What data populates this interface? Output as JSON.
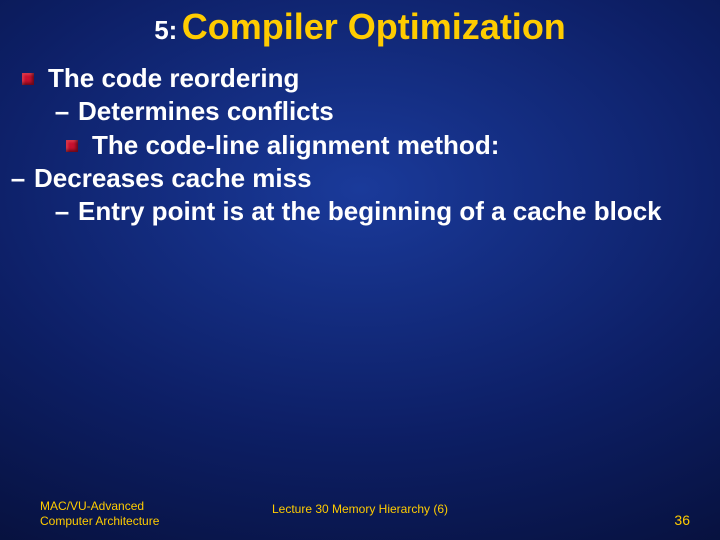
{
  "title": {
    "prefix": "5:",
    "main": "Compiler Optimization"
  },
  "bullets": {
    "line1": "The code reordering",
    "line2_dash": "–",
    "line2": "Determines conflicts",
    "line3": "The code-line alignment method:",
    "line4_dash": "–",
    "line4": "Decreases cache miss",
    "line5_dash": "–",
    "line5": "Entry point is at the beginning of a cache block"
  },
  "footer": {
    "left_line1": "MAC/VU-Advanced",
    "left_line2": "Computer Architecture",
    "center": "Lecture 30 Memory Hierarchy (6)",
    "page": "36"
  }
}
